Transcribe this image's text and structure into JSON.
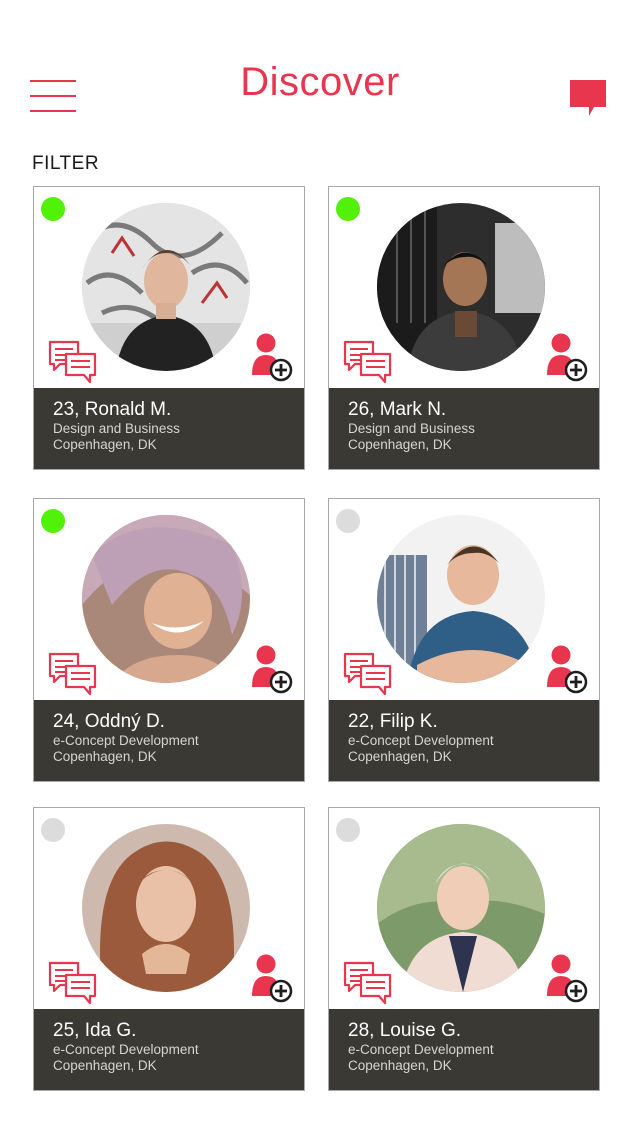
{
  "header": {
    "title": "Discover",
    "menu_icon": "hamburger-menu-icon",
    "chat_icon": "chat-bubble-icon"
  },
  "filter_label": "FILTER",
  "colors": {
    "accent": "#e8364f",
    "online": "#52f10a",
    "offline": "#dcdcdc",
    "card_footer": "#3a3934"
  },
  "profiles": [
    {
      "name": "23, Ronald M.",
      "field": "Design and Business",
      "location": "Copenhagen, DK",
      "online": true
    },
    {
      "name": "26, Mark N.",
      "field": "Design and Business",
      "location": "Copenhagen, DK",
      "online": true
    },
    {
      "name": "24, Oddný D.",
      "field": "e-Concept Development",
      "location": "Copenhagen, DK",
      "online": true
    },
    {
      "name": "22, Filip K.",
      "field": "e-Concept Development",
      "location": "Copenhagen, DK",
      "online": false
    },
    {
      "name": "25, Ida G.",
      "field": "e-Concept Development",
      "location": "Copenhagen, DK",
      "online": false
    },
    {
      "name": "28, Louise G.",
      "field": "e-Concept Development",
      "location": "Copenhagen, DK",
      "online": false
    }
  ]
}
